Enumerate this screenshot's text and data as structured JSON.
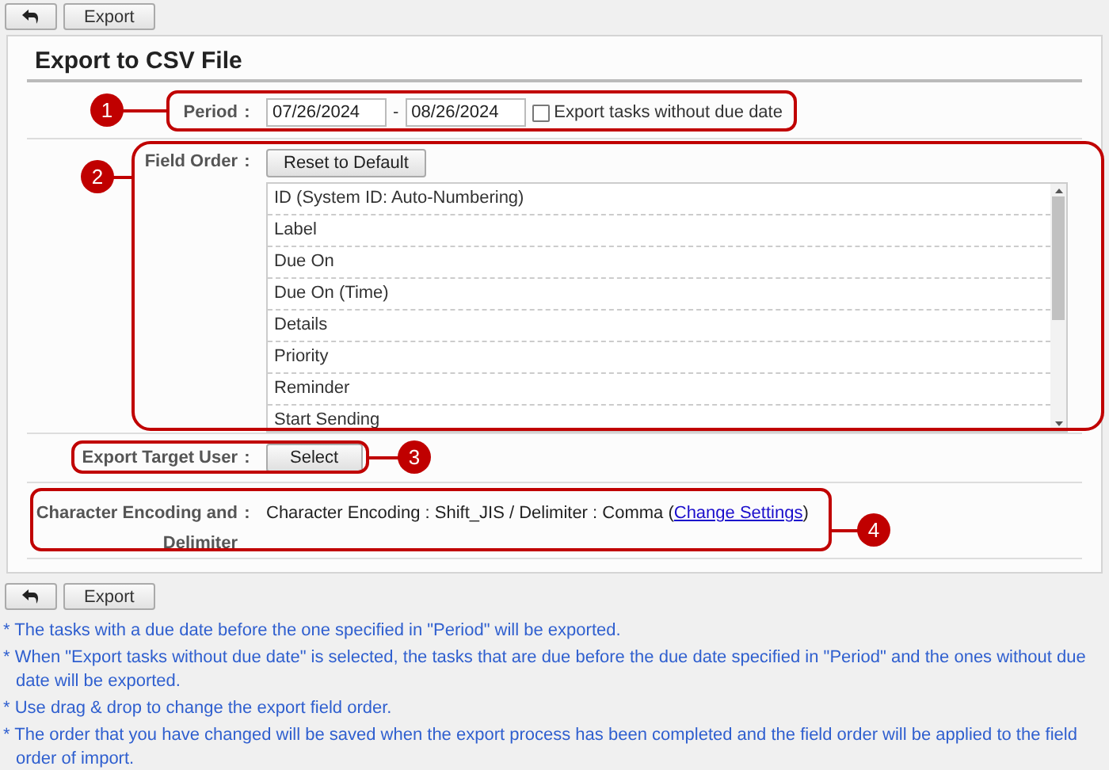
{
  "toolbar_top": [
    {
      "kind": "back"
    },
    {
      "kind": "text",
      "label": "Export"
    }
  ],
  "title": "Export to CSV File",
  "period": {
    "callout": "1",
    "label": "Period",
    "colon": ":",
    "from": "07/26/2024",
    "dash": "-",
    "to": "08/26/2024",
    "checkbox": {
      "label": "Export tasks without due date",
      "checked": false
    }
  },
  "field_order": {
    "callout": "2",
    "label": "Field Order",
    "colon": ":",
    "reset_button": "Reset to Default",
    "items": [
      "ID (System ID: Auto-Numbering)",
      "Label",
      "Due On",
      "Due On (Time)",
      "Details",
      "Priority",
      "Reminder",
      "Start Sending"
    ]
  },
  "target_user": {
    "callout": "3",
    "label": "Export Target User",
    "colon": ":",
    "button": "Select"
  },
  "encoding": {
    "callout": "4",
    "label": "Character Encoding and Delimiter",
    "colon": ":",
    "value": "Character Encoding : Shift_JIS / Delimiter : Comma (",
    "link": "Change Settings",
    "value_end": ")"
  },
  "toolbar_bottom": [
    {
      "kind": "back"
    },
    {
      "kind": "text",
      "label": "Export"
    }
  ],
  "notes": [
    "* The tasks with a due date before the one specified in \"Period\" will be exported.",
    "* When \"Export tasks without due date\" is selected, the tasks that are due before the due date specified in \"Period\" and the ones without due date will be exported.",
    "* Use drag & drop to change the export field order.",
    "* The order that you have changed will be saved when the export process has been completed and the field order will be applied to the field order of import."
  ]
}
